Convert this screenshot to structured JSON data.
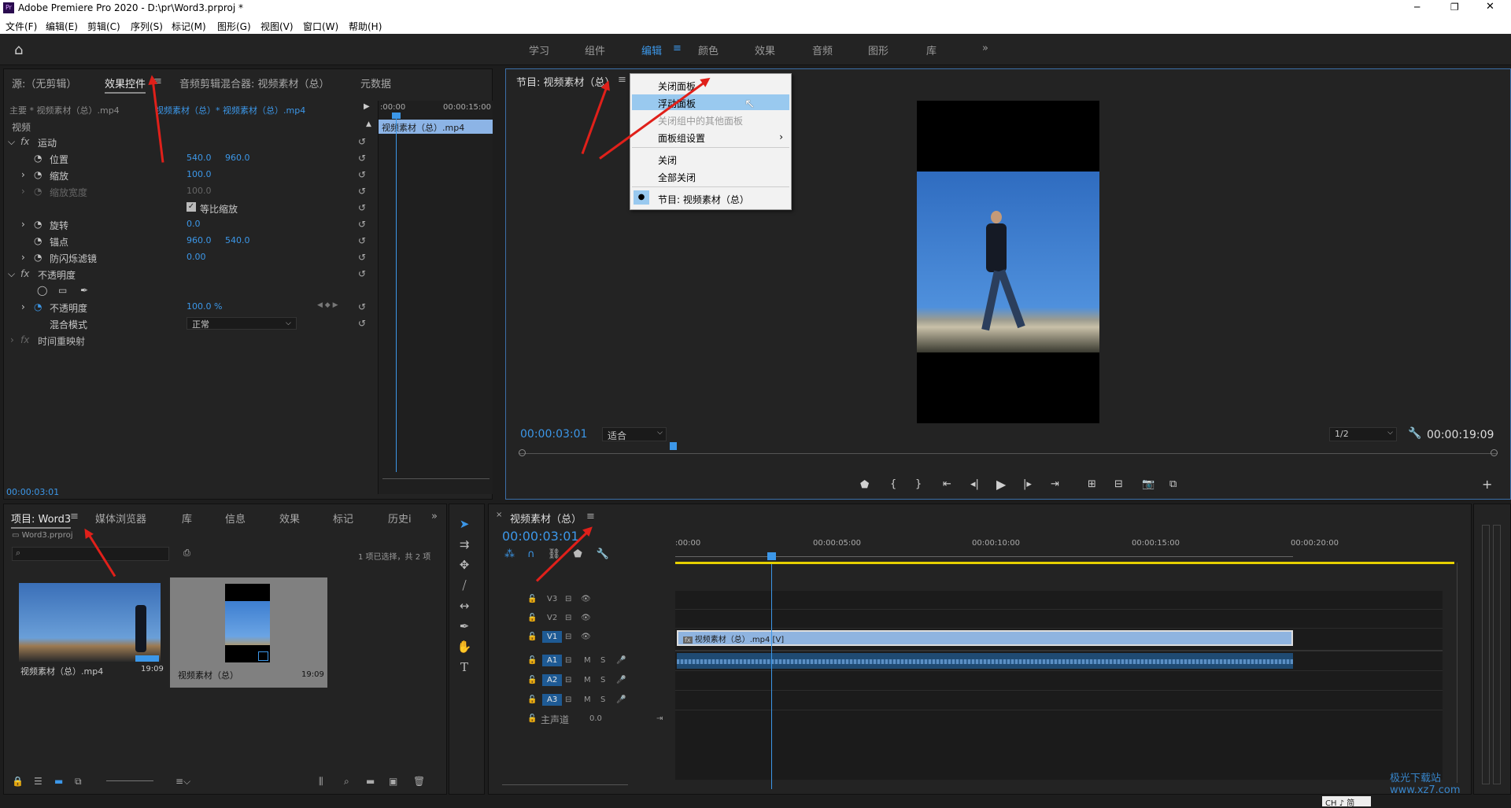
{
  "window": {
    "title": "Adobe Premiere Pro 2020 - D:\\pr\\Word3.prproj *",
    "app_icon": "Pr",
    "controls": [
      "─",
      "❐",
      "✕"
    ]
  },
  "menu": [
    "文件(F)",
    "编辑(E)",
    "剪辑(C)",
    "序列(S)",
    "标记(M)",
    "图形(G)",
    "视图(V)",
    "窗口(W)",
    "帮助(H)"
  ],
  "workspaces": [
    "学习",
    "组件",
    "编辑",
    "颜色",
    "效果",
    "音频",
    "图形",
    "库"
  ],
  "workspace_active": "编辑",
  "source_panel": {
    "tabs": [
      "源:（无剪辑）",
      "效果控件",
      "音频剪辑混合器: 视频素材（总）",
      "元数据"
    ],
    "master_label": "主要 * 视频素材（总）.mp4",
    "clip_label": "视频素材（总）* 视频素材（总）.mp4",
    "ruler_start": ":00:00",
    "ruler_end": "00:00:15:00",
    "clip_bar": "视频素材（总）.mp4",
    "section": "视频",
    "motion": "运动",
    "rows": [
      {
        "name": "位置",
        "v1": "540.0",
        "v2": "960.0"
      },
      {
        "name": "缩放",
        "v1": "100.0",
        "v2": ""
      },
      {
        "name": "缩放宽度",
        "v1": "100.0",
        "v2": ""
      },
      {
        "name": "等比缩放",
        "v1": "",
        "v2": ""
      },
      {
        "name": "旋转",
        "v1": "0.0",
        "v2": ""
      },
      {
        "name": "锚点",
        "v1": "960.0",
        "v2": "540.0"
      },
      {
        "name": "防闪烁滤镜",
        "v1": "0.00",
        "v2": ""
      }
    ],
    "opacity": "不透明度",
    "opacity_row": {
      "name": "不透明度",
      "value": "100.0 %",
      "kf": "0"
    },
    "blend": {
      "name": "混合模式",
      "value": "正常"
    },
    "time_remap": "时间重映射",
    "timecode": "00:00:03:01"
  },
  "program_panel": {
    "title": "节目: 视频素材（总）",
    "timecode": "00:00:03:01",
    "fit": "适合",
    "resolution": "1/2",
    "duration": "00:00:19:09"
  },
  "context_menu": {
    "items": [
      "关闭面板",
      "浮动面板",
      "关闭组中的其他面板",
      "面板组设置",
      "关闭",
      "全部关闭",
      "节目: 视频素材（总）"
    ],
    "highlighted": "浮动面板",
    "disabled": "关闭组中的其他面板"
  },
  "project_panel": {
    "tabs": [
      "项目: Word3",
      "媒体浏览器",
      "库",
      "信息",
      "效果",
      "标记",
      "历史i"
    ],
    "path": "Word3.prproj",
    "selection": "1 项已选择，共 2 项",
    "items": [
      {
        "name": "视频素材（总）.mp4",
        "dur": "19:09"
      },
      {
        "name": "视频素材（总）",
        "dur": "19:09"
      }
    ]
  },
  "timeline": {
    "title": "视频素材（总）",
    "timecode": "00:00:03:01",
    "ruler": [
      ":00:00",
      "00:00:05:00",
      "00:00:10:00",
      "00:00:15:00",
      "00:00:20:00"
    ],
    "video_tracks": [
      "V3",
      "V2",
      "V1"
    ],
    "audio_tracks": [
      "A1",
      "A2",
      "A3"
    ],
    "master": "主声道",
    "master_value": "0.0",
    "clip": "视频素材（总）.mp4 [V]",
    "m": "M",
    "s": "S"
  },
  "colors": {
    "accent": "#3c97e8",
    "arrow": "#e0201a",
    "yellow": "#e6d000"
  },
  "watermark": "极光下载站 www.xz7.com",
  "ime": "CH ♪ 简"
}
